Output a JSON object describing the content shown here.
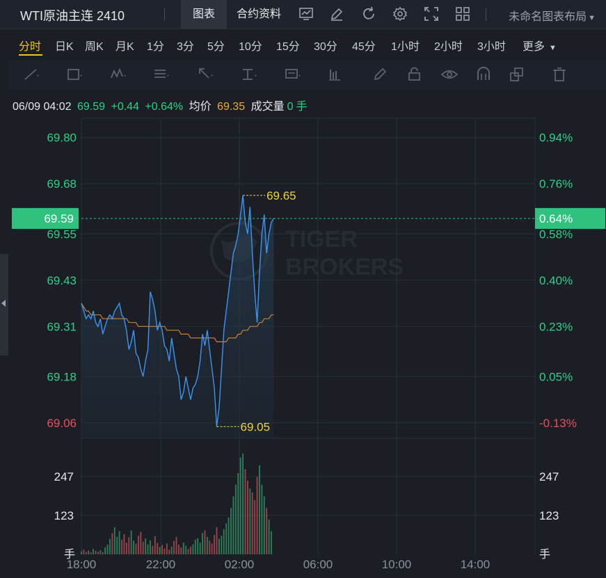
{
  "header": {
    "title": "WTI原油主连 2410",
    "tabs": [
      {
        "label": "图表",
        "active": true
      },
      {
        "label": "合约资料",
        "active": false
      }
    ],
    "icons": [
      "chart-settings-icon",
      "edit-icon",
      "refresh-icon",
      "gear-icon",
      "fullscreen-icon",
      "grid-layout-icon"
    ],
    "layout_label": "未命名图表布局"
  },
  "periods": [
    "分时",
    "日K",
    "周K",
    "月K",
    "1分",
    "3分",
    "5分",
    "10分",
    "15分",
    "30分",
    "45分",
    "1小时",
    "2小时",
    "3小时",
    "更多"
  ],
  "active_period": "分时",
  "toolbar_icons": [
    "line-tool-icon",
    "rect-tool-icon",
    "wave-tool-icon",
    "fib-tool-icon",
    "arrow-tool-icon",
    "text-tool-icon",
    "annotation-tool-icon",
    "measure-tool-icon",
    "pen-icon",
    "lock-icon",
    "eye-icon",
    "magnet-icon",
    "copy-icon",
    "trash-icon"
  ],
  "info": {
    "time": "06/09 04:02",
    "price": "69.59",
    "change": "+0.44",
    "change_pct": "+0.64%",
    "avg_label": "均价",
    "avg": "69.35",
    "volume_label": "成交量",
    "volume": "0",
    "volume_unit": "手"
  },
  "watermark": [
    "TIGER",
    "BROKERS"
  ],
  "colors": {
    "up": "#2ed18a",
    "down": "#e5525a",
    "price_line": "#3d95f2",
    "avg_line": "#c7823d",
    "marker": "#f0d23c",
    "current": "#2ec27e"
  },
  "chart_data": {
    "type": "line",
    "x_ticks": [
      "18:00",
      "22:00",
      "02:00",
      "06:00",
      "10:00",
      "14:00"
    ],
    "y_ticks_left": [
      "69.80",
      "69.68",
      "69.55",
      "69.43",
      "69.31",
      "69.18",
      "69.06"
    ],
    "y_ticks_right": [
      "0.94%",
      "0.76%",
      "0.58%",
      "0.40%",
      "0.23%",
      "0.05%",
      "-0.13%"
    ],
    "ylim": [
      69.02,
      69.85
    ],
    "current_price": "69.59",
    "current_pct": "0.64%",
    "high_label": "69.65",
    "low_label": "69.05",
    "volume_ticks": [
      "247",
      "123"
    ],
    "volume_unit": "手",
    "series": [
      {
        "name": "价格",
        "values": [
          69.37,
          69.35,
          69.33,
          69.34,
          69.33,
          69.35,
          69.32,
          69.31,
          69.33,
          69.29,
          69.31,
          69.33,
          69.34,
          69.33,
          69.35,
          69.36,
          69.37,
          69.34,
          69.33,
          69.3,
          69.25,
          69.27,
          69.3,
          69.24,
          69.23,
          69.2,
          69.18,
          69.22,
          69.25,
          69.4,
          69.38,
          69.35,
          69.3,
          69.32,
          69.3,
          69.26,
          69.25,
          69.22,
          69.28,
          69.24,
          69.2,
          69.18,
          69.12,
          69.14,
          69.18,
          69.15,
          69.12,
          69.15,
          69.16,
          69.18,
          69.22,
          69.29,
          69.26,
          69.3,
          69.25,
          69.2,
          69.15,
          69.05,
          69.1,
          69.2,
          69.3,
          69.35,
          69.4,
          69.45,
          69.5,
          69.52,
          69.55,
          69.6,
          69.65,
          69.58,
          69.55,
          69.62,
          69.5,
          69.4,
          69.32,
          69.45,
          69.55,
          69.6,
          69.5,
          69.55,
          69.58,
          69.59
        ]
      },
      {
        "name": "均价",
        "values": [
          69.37,
          69.36,
          69.35,
          69.35,
          69.34,
          69.34,
          69.34,
          69.34,
          69.34,
          69.33,
          69.33,
          69.33,
          69.33,
          69.33,
          69.33,
          69.33,
          69.33,
          69.33,
          69.33,
          69.33,
          69.32,
          69.32,
          69.32,
          69.32,
          69.31,
          69.31,
          69.31,
          69.31,
          69.31,
          69.31,
          69.31,
          69.31,
          69.31,
          69.31,
          69.31,
          69.31,
          69.3,
          69.3,
          69.3,
          69.3,
          69.3,
          69.3,
          69.29,
          69.29,
          69.29,
          69.29,
          69.28,
          69.28,
          69.28,
          69.28,
          69.28,
          69.28,
          69.28,
          69.28,
          69.28,
          69.28,
          69.28,
          69.27,
          69.27,
          69.27,
          69.27,
          69.27,
          69.28,
          69.28,
          69.28,
          69.28,
          69.29,
          69.29,
          69.3,
          69.3,
          69.3,
          69.31,
          69.31,
          69.31,
          69.31,
          69.32,
          69.32,
          69.33,
          69.33,
          69.33,
          69.34,
          69.34
        ]
      }
    ],
    "volume": [
      8,
      12,
      6,
      10,
      5,
      14,
      9,
      7,
      11,
      6,
      18,
      25,
      40,
      55,
      70,
      45,
      60,
      38,
      52,
      30,
      44,
      62,
      35,
      28,
      48,
      58,
      33,
      41,
      26,
      36,
      22,
      47,
      30,
      19,
      24,
      15,
      28,
      12,
      20,
      35,
      45,
      25,
      18,
      30,
      22,
      14,
      20,
      26,
      38,
      42,
      30,
      55,
      62,
      45,
      35,
      28,
      50,
      70,
      40,
      48,
      65,
      80,
      95,
      120,
      150,
      180,
      210,
      250,
      260,
      220,
      190,
      170,
      160,
      140,
      200,
      230,
      180,
      150,
      120,
      90,
      60,
      0
    ]
  }
}
